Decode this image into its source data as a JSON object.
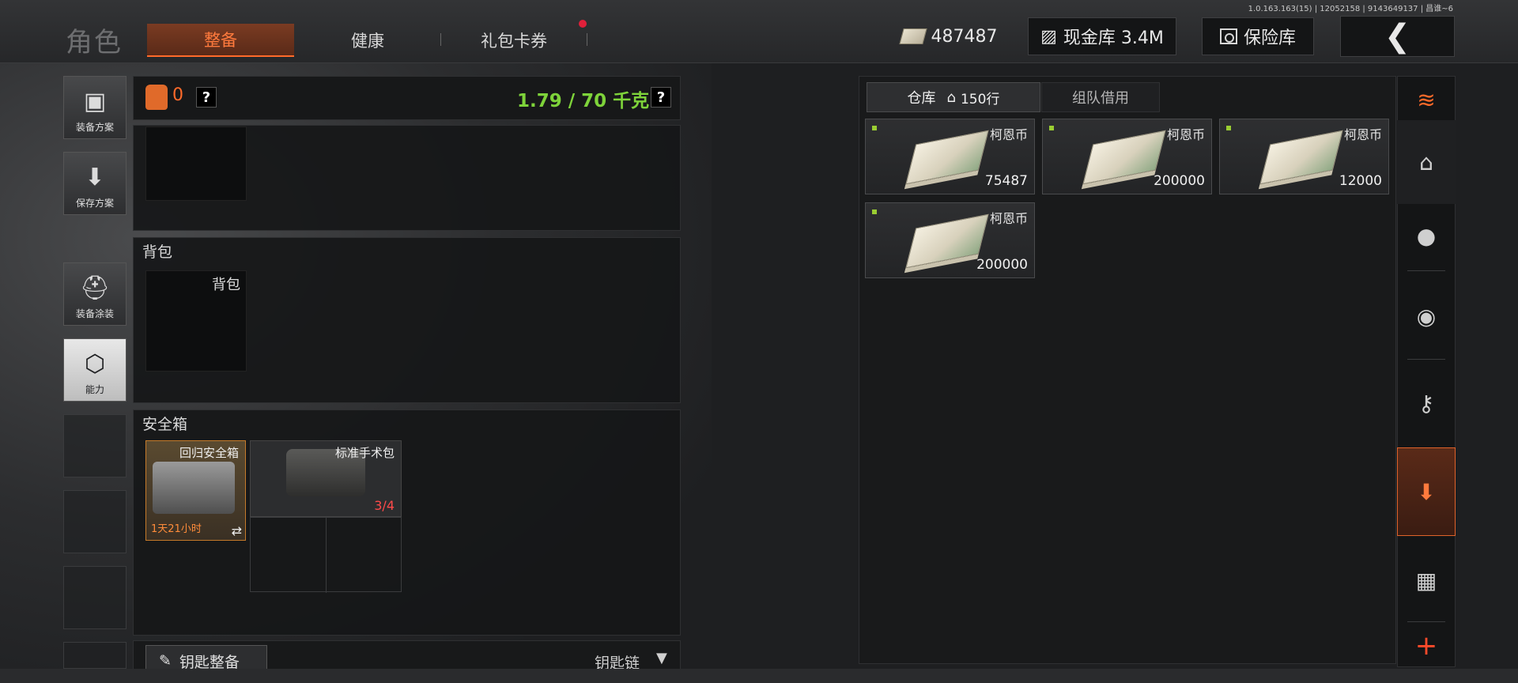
{
  "version_info": "1.0.163.163(15) | 12052158 | 9143649137 | 昌谁~6",
  "header": {
    "title": "角色",
    "tabs": [
      {
        "label": "整备",
        "active": true
      },
      {
        "label": "健康",
        "active": false
      },
      {
        "label": "礼包卡券",
        "active": false,
        "notification": true
      }
    ],
    "currency_amount": "487487",
    "cash_vault_label": "现金库 3.4M",
    "insurance_label": "保险库",
    "back_icon": "chevron-left-icon"
  },
  "left_menu": [
    {
      "label": "装备方案",
      "icon": "vest-icon"
    },
    {
      "label": "保存方案",
      "icon": "download-icon"
    },
    {
      "label": "装备涂装",
      "icon": "helmet-icon"
    },
    {
      "label": "能力",
      "icon": "lightning-hex-icon",
      "active": true
    }
  ],
  "loadout": {
    "armor_count": "0",
    "help_symbol": "?",
    "weight": "1.79 / 70 千克",
    "backpack_section": "背包",
    "backpack_slot_label": "背包",
    "safe_section": "安全箱",
    "safe_item": {
      "name": "回归安全箱",
      "timer": "1天21小时",
      "swap_icon": "⇄"
    },
    "medkit_item": {
      "name": "标准手术包",
      "count": "3/4"
    },
    "key_button": "钥匙整备",
    "key_chain_label": "钥匙链"
  },
  "storage": {
    "tab_warehouse": "仓库",
    "warehouse_rows": "150行",
    "tab_team": "组队借用",
    "items": [
      {
        "name": "柯恩币",
        "qty": "75487"
      },
      {
        "name": "柯恩币",
        "qty": "200000"
      },
      {
        "name": "柯恩币",
        "qty": "12000"
      },
      {
        "name": "柯恩币",
        "qty": "200000"
      }
    ]
  },
  "right_sidebar": [
    {
      "icon": "layers-refresh-icon"
    },
    {
      "icon": "home-icon"
    },
    {
      "icon": "grenade-icon"
    },
    {
      "icon": "coins-icon"
    },
    {
      "icon": "key-icon"
    },
    {
      "icon": "inventory-in-icon",
      "active": true
    },
    {
      "icon": "box-icon"
    },
    {
      "icon": "plus-icon"
    }
  ],
  "colors": {
    "accent": "#ff6a2a",
    "weight": "#7ed33a",
    "active_tab_bg": "#7a3b22"
  }
}
